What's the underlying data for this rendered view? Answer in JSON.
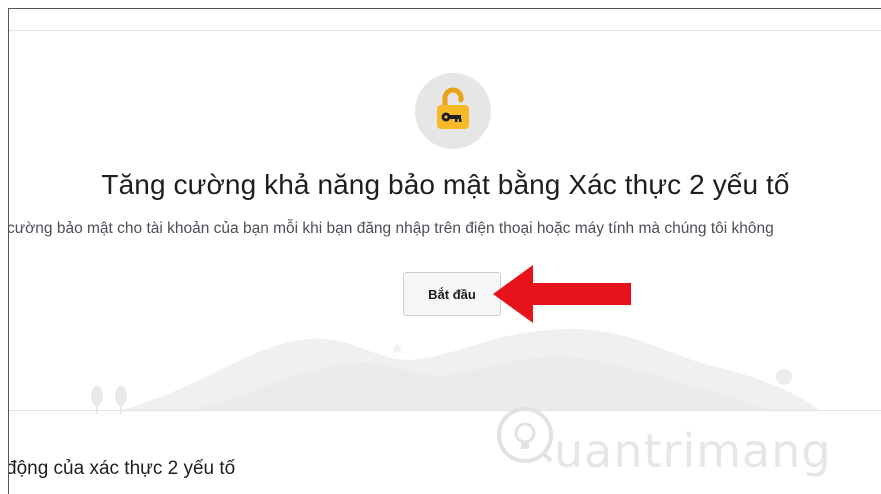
{
  "page": {
    "title": "Tăng cường khả năng bảo mật bằng Xác thực 2 yếu tố",
    "description": "cường bảo mật cho tài khoản của bạn mỗi khi bạn đăng nhập trên điện thoại hoặc máy tính mà chúng tôi không",
    "start_button": "Bắt đầu",
    "section_heading": "động của xác thực 2 yếu tố"
  },
  "icons": {
    "lock": "unlocked-padlock-with-key-icon",
    "arrow": "red-arrow-pointing-left-icon"
  },
  "watermark": {
    "text": "uantrimang"
  },
  "colors": {
    "lock_body": "#f7b928",
    "lock_shackle": "#e8a317",
    "icon_circle": "#e6e6e6",
    "arrow": "#e8121a",
    "button_bg": "#f5f6f7",
    "title_text": "#1c1e21"
  }
}
